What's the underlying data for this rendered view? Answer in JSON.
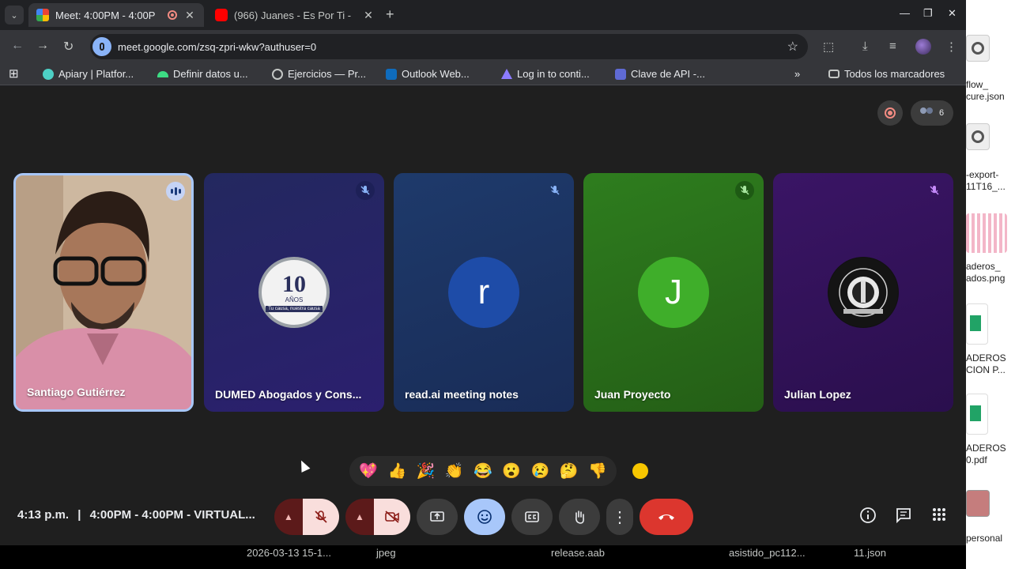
{
  "browser": {
    "tabs": [
      {
        "title": "Meet: 4:00PM - 4:00P",
        "active": true
      },
      {
        "title": "(966) Juanes - Es Por Ti -",
        "active": false
      }
    ],
    "url": "meet.google.com/zsq-zpri-wkw?authuser=0",
    "bookmarks": [
      "Apiary | Platfor...",
      "Definir datos u...",
      "Ejercicios — Pr...",
      "Outlook Web...",
      "Log in to conti...",
      "Clave de API -..."
    ],
    "bookmarks_overflow": "»",
    "all_bookmarks": "Todos los marcadores"
  },
  "meet": {
    "participant_count": "6",
    "tiles": [
      {
        "name": "Santiago Gutiérrez",
        "type": "video",
        "speaking": true
      },
      {
        "name": "DUMED Abogados y Cons...",
        "type": "logo",
        "logo_text": "10",
        "logo_sub": "AÑOS",
        "logo_tag": "Tu causa, nuestra causa",
        "muted": true
      },
      {
        "name": "read.ai meeting notes",
        "type": "initial",
        "initial": "r",
        "color": "#1e4ca8",
        "muted": true
      },
      {
        "name": "Juan Proyecto",
        "type": "initial",
        "initial": "J",
        "color": "#3fae2a",
        "muted": true
      },
      {
        "name": "Julian Lopez",
        "type": "logo2",
        "muted": true
      }
    ],
    "reactions": [
      "💖",
      "👍",
      "🎉",
      "👏",
      "😂",
      "😮",
      "😢",
      "🤔",
      "👎"
    ],
    "clock": "4:13 p.m.",
    "separator": "|",
    "meeting_title": "4:00PM - 4:00PM - VIRTUAL..."
  },
  "desktop_files": [
    {
      "label1": "flow_",
      "label2": "cure.json"
    },
    {
      "label1": "-export-",
      "label2": "11T16_..."
    },
    {
      "label1": "aderos_",
      "label2": "ados.png"
    },
    {
      "label1": "ADEROS",
      "label2": "CION P..."
    },
    {
      "label1": "ADEROS",
      "label2": "0.pdf"
    },
    {
      "label1": "personal",
      "label2": ""
    }
  ],
  "downloads": [
    "2026-03-13 15-1...",
    "jpeg",
    "release.aab",
    "asistido_pc112...",
    "11.json"
  ]
}
